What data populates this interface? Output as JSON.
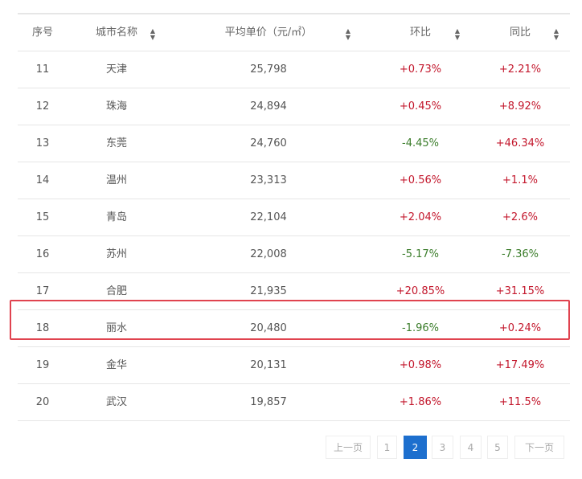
{
  "headers": {
    "index": "序号",
    "city": "城市名称",
    "price": "平均单价（元/㎡）",
    "mom": "环比",
    "yoy": "同比"
  },
  "rows": [
    {
      "index": "11",
      "city": "天津",
      "price": "25,798",
      "mom": "+0.73%",
      "yoy": "+2.21%"
    },
    {
      "index": "12",
      "city": "珠海",
      "price": "24,894",
      "mom": "+0.45%",
      "yoy": "+8.92%"
    },
    {
      "index": "13",
      "city": "东莞",
      "price": "24,760",
      "mom": "-4.45%",
      "yoy": "+46.34%"
    },
    {
      "index": "14",
      "city": "温州",
      "price": "23,313",
      "mom": "+0.56%",
      "yoy": "+1.1%"
    },
    {
      "index": "15",
      "city": "青岛",
      "price": "22,104",
      "mom": "+2.04%",
      "yoy": "+2.6%"
    },
    {
      "index": "16",
      "city": "苏州",
      "price": "22,008",
      "mom": "-5.17%",
      "yoy": "-7.36%"
    },
    {
      "index": "17",
      "city": "合肥",
      "price": "21,935",
      "mom": "+20.85%",
      "yoy": "+31.15%"
    },
    {
      "index": "18",
      "city": "丽水",
      "price": "20,480",
      "mom": "-1.96%",
      "yoy": "+0.24%"
    },
    {
      "index": "19",
      "city": "金华",
      "price": "20,131",
      "mom": "+0.98%",
      "yoy": "+17.49%"
    },
    {
      "index": "20",
      "city": "武汉",
      "price": "19,857",
      "mom": "+1.86%",
      "yoy": "+11.5%"
    }
  ],
  "pagination": {
    "prev": "上一页",
    "pages": [
      "1",
      "2",
      "3",
      "4",
      "5"
    ],
    "current": "2",
    "next": "下一页"
  },
  "colors": {
    "up": "#c3172c",
    "down": "#3b7d2b",
    "highlight": "#e0434f",
    "active": "#1d6fce"
  }
}
